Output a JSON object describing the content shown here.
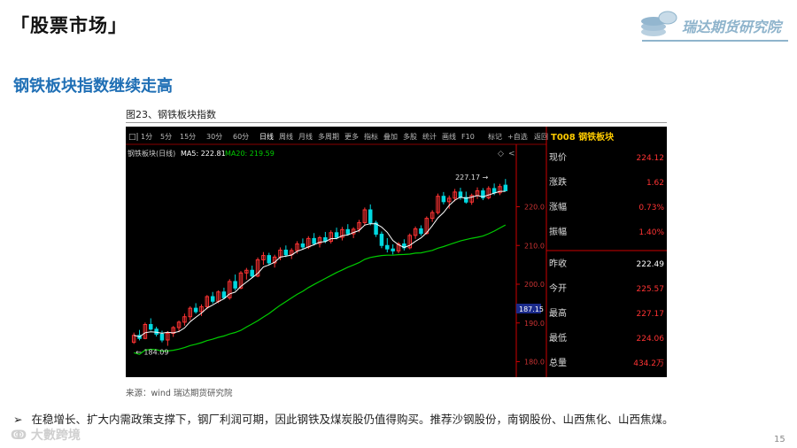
{
  "slide": {
    "section_title": "「股票市场」",
    "logo_text": "瑞达期货研究院",
    "headline": "钢铁板块指数继续走高",
    "figure_caption": "图23、钢铁板块指数",
    "source": "来源：wind   瑞达期货研究院",
    "bullet_marker": "➢",
    "bullet_text": "在稳增长、扩大内需政策支撑下，钢厂利润可期，因此钢铁及煤炭股仍值得购买。推荐沙钢股份，南钢股份、山西焦化、山西焦煤。",
    "watermark": "大數跨境",
    "page_number": "15"
  },
  "terminal": {
    "toolbar": [
      "1分",
      "5分",
      "15分",
      "30分",
      "60分",
      "日线",
      "周线",
      "月线",
      "多周期",
      "更多",
      "指标",
      "叠加",
      "多股",
      "统计",
      "画线",
      "F10",
      "标记",
      "+自选",
      "返回"
    ],
    "toolbar_active": "日线",
    "legend_name": "钢铁板块(日线)",
    "legend_ma5": "MA5: 222.81",
    "legend_ma20": "MA20: 219.59",
    "high_label": "227.17",
    "low_label": "184.09",
    "price_marker": "187.15",
    "axis_ticks": [
      "220.0",
      "210.0",
      "200.0",
      "190.0",
      "180.0"
    ],
    "panel_title": "T008 钢铁板块",
    "quote": [
      {
        "label": "现价",
        "value": "224.12"
      },
      {
        "label": "涨跌",
        "value": "1.62"
      },
      {
        "label": "涨幅",
        "value": "0.73%"
      },
      {
        "label": "振幅",
        "value": "1.40%"
      },
      {
        "label": "昨收",
        "value": "222.49"
      },
      {
        "label": "今开",
        "value": "225.57"
      },
      {
        "label": "最高",
        "value": "227.17"
      },
      {
        "label": "最低",
        "value": "224.06"
      },
      {
        "label": "总量",
        "value": "434.2万"
      }
    ],
    "colors": {
      "up": "#ff3333",
      "down": "#00d8e0",
      "ma5": "#ffffff",
      "ma20": "#00cc00",
      "bg": "#000000",
      "axis": "#cc0000"
    }
  },
  "chart_data": {
    "type": "candlestick",
    "title": "钢铁板块(日线)",
    "ylim": [
      176,
      232
    ],
    "y_ticks": [
      180,
      190,
      200,
      210,
      220
    ],
    "ohlc": [
      [
        185.0,
        187.5,
        184.6,
        186.8
      ],
      [
        186.8,
        188.2,
        185.5,
        186.0
      ],
      [
        186.0,
        190.1,
        185.8,
        189.6
      ],
      [
        189.6,
        191.2,
        188.0,
        188.4
      ],
      [
        188.4,
        189.0,
        186.5,
        187.1
      ],
      [
        187.1,
        188.0,
        185.0,
        185.6
      ],
      [
        185.6,
        187.9,
        184.1,
        187.3
      ],
      [
        187.3,
        189.2,
        186.4,
        188.8
      ],
      [
        188.8,
        190.6,
        187.6,
        190.2
      ],
      [
        190.2,
        192.4,
        189.3,
        191.6
      ],
      [
        191.6,
        194.3,
        190.7,
        193.8
      ],
      [
        193.8,
        195.1,
        192.4,
        192.9
      ],
      [
        192.9,
        194.8,
        191.8,
        194.2
      ],
      [
        194.2,
        197.2,
        193.5,
        196.8
      ],
      [
        196.8,
        198.0,
        195.0,
        195.6
      ],
      [
        195.6,
        198.4,
        195.1,
        198.0
      ],
      [
        198.0,
        199.1,
        196.1,
        196.5
      ],
      [
        196.5,
        201.3,
        196.0,
        200.7
      ],
      [
        200.7,
        202.5,
        198.4,
        199.0
      ],
      [
        199.0,
        203.4,
        198.7,
        202.9
      ],
      [
        202.9,
        204.2,
        201.2,
        203.6
      ],
      [
        203.6,
        204.8,
        201.6,
        202.1
      ],
      [
        202.1,
        206.9,
        201.8,
        206.3
      ],
      [
        206.3,
        208.3,
        205.0,
        207.4
      ],
      [
        207.4,
        208.1,
        204.9,
        205.5
      ],
      [
        205.5,
        207.6,
        204.3,
        207.0
      ],
      [
        207.0,
        209.5,
        206.2,
        208.8
      ],
      [
        208.8,
        210.0,
        207.0,
        207.6
      ],
      [
        207.6,
        209.3,
        206.5,
        208.7
      ],
      [
        208.7,
        211.1,
        207.9,
        210.4
      ],
      [
        210.4,
        211.8,
        209.0,
        209.6
      ],
      [
        209.6,
        212.4,
        209.1,
        211.8
      ],
      [
        211.8,
        213.2,
        210.0,
        210.5
      ],
      [
        210.5,
        212.5,
        209.5,
        212.0
      ],
      [
        212.0,
        213.5,
        210.6,
        211.1
      ],
      [
        211.1,
        213.9,
        210.5,
        213.3
      ],
      [
        213.3,
        214.6,
        211.6,
        212.1
      ],
      [
        212.1,
        214.8,
        211.3,
        214.1
      ],
      [
        214.1,
        215.5,
        212.6,
        213.0
      ],
      [
        213.0,
        214.7,
        211.9,
        214.2
      ],
      [
        214.2,
        216.6,
        213.4,
        215.9
      ],
      [
        215.9,
        219.8,
        215.1,
        219.2
      ],
      [
        219.2,
        220.6,
        215.2,
        215.8
      ],
      [
        215.8,
        216.4,
        212.2,
        212.9
      ],
      [
        212.9,
        213.6,
        209.3,
        210.0
      ],
      [
        210.0,
        211.9,
        208.2,
        209.1
      ],
      [
        209.1,
        210.3,
        207.7,
        208.6
      ],
      [
        208.6,
        210.9,
        208.0,
        210.4
      ],
      [
        210.4,
        211.6,
        208.7,
        209.4
      ],
      [
        209.4,
        213.1,
        209.0,
        212.6
      ],
      [
        212.6,
        214.9,
        211.7,
        214.3
      ],
      [
        214.3,
        215.2,
        212.5,
        213.1
      ],
      [
        213.1,
        217.5,
        212.8,
        217.0
      ],
      [
        217.0,
        219.1,
        216.1,
        218.5
      ],
      [
        218.5,
        223.4,
        218.0,
        222.7
      ],
      [
        222.7,
        223.8,
        220.6,
        221.3
      ],
      [
        221.3,
        222.9,
        219.5,
        222.2
      ],
      [
        222.2,
        224.6,
        221.4,
        223.8
      ],
      [
        223.8,
        224.9,
        221.8,
        222.4
      ],
      [
        222.4,
        223.9,
        220.8,
        221.2
      ],
      [
        221.2,
        223.4,
        220.5,
        222.9
      ],
      [
        222.9,
        225.0,
        222.0,
        224.1
      ],
      [
        224.1,
        224.8,
        221.7,
        222.3
      ],
      [
        222.3,
        225.3,
        221.9,
        224.7
      ],
      [
        224.7,
        226.0,
        223.0,
        223.6
      ],
      [
        223.6,
        225.9,
        223.0,
        225.2
      ],
      [
        225.57,
        227.17,
        224.06,
        224.12
      ]
    ],
    "ma5_last": 222.81,
    "ma20_last": 219.59
  }
}
